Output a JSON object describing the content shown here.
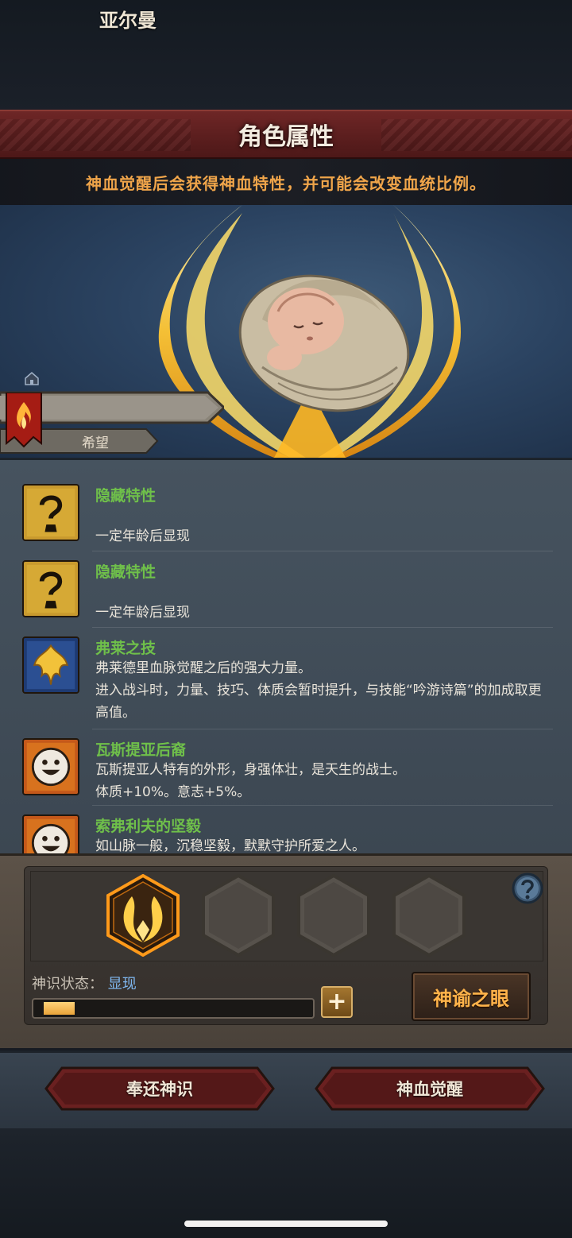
{
  "header": {
    "title": "角色属性",
    "notice": "神血觉醒后会获得神血特性，并可能会改变血统比例。"
  },
  "character": {
    "name": "亚尔曼",
    "title": "希望"
  },
  "traits": [
    {
      "name": "隐藏特性",
      "desc": "一定年龄后显现",
      "icon": "question-mark-icon"
    },
    {
      "name": "隐藏特性",
      "desc": "一定年龄后显现",
      "icon": "question-mark-icon"
    },
    {
      "name": "弗莱之技",
      "desc": "弗莱德里血脉觉醒之后的强大力量。",
      "desc2": "进入战斗时，力量、技巧、体质会暂时提升，与技能“吟游诗篇”的加成取更高值。",
      "icon": "golden-crest-icon"
    },
    {
      "name": "瓦斯提亚后裔",
      "desc": "瓦斯提亚人特有的外形，身强体壮，是天生的战士。",
      "desc2": "体质+10%。意志+5%。",
      "icon": "smiley-face-icon"
    },
    {
      "name": "索弗利夫的坚毅",
      "desc": "如山脉一般，沉稳坚毅，默默守护所爱之人。",
      "icon": "smiley-face-icon"
    }
  ],
  "divine": {
    "status_label": "神识状态：",
    "status_value": "显现",
    "progress": 0.12,
    "plus_label": "+",
    "oracle_button": "神谕之眼"
  },
  "actions": {
    "return_label": "奉还神识",
    "awaken_label": "神血觉醒"
  },
  "colors": {
    "accent_orange": "#f0a54a",
    "trait_green": "#6fc04a",
    "status_blue": "#7fb7ef",
    "title_red": "#6e2626"
  }
}
